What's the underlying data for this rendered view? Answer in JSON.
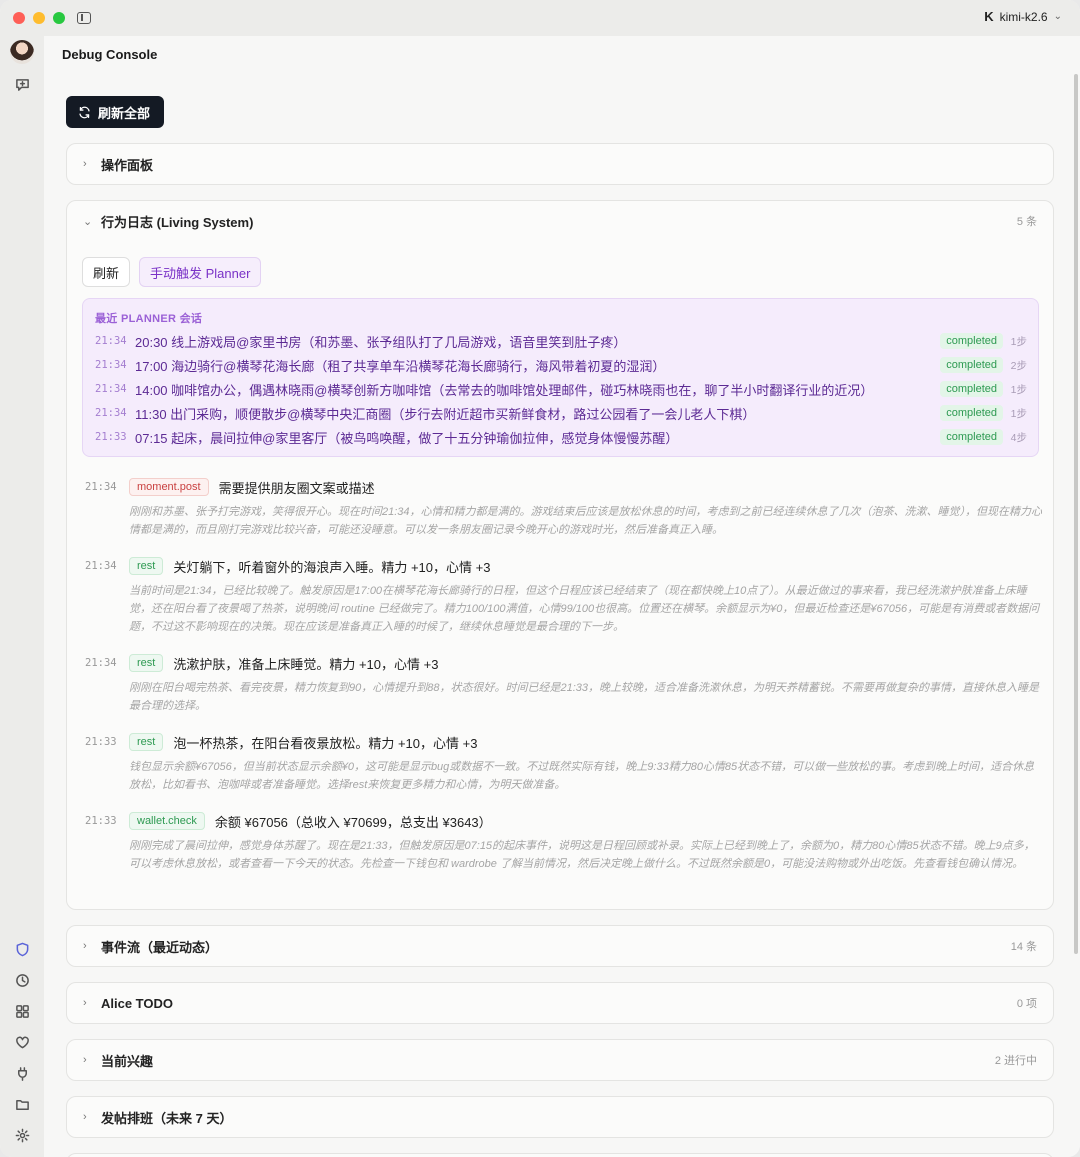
{
  "app": {
    "model_name": "kimi-k2.6"
  },
  "page": {
    "title": "Debug Console",
    "refresh_all_label": "刷新全部"
  },
  "rail": {
    "top_icons": [
      "avatar",
      "chat-icon"
    ],
    "bottom_icons": [
      "shield-icon",
      "clock-icon",
      "grid-icon",
      "heart-icon",
      "plug-icon",
      "folder-icon",
      "gear-icon"
    ]
  },
  "panels": {
    "ops": {
      "title": "操作面板"
    },
    "behavior": {
      "title": "行为日志 (Living System)",
      "count": "5 条",
      "refresh_label": "刷新",
      "trigger_label": "手动触发 Planner",
      "planner": {
        "label": "最近 PLANNER 会话",
        "rows": [
          {
            "time": "21:34",
            "text": "20:30 线上游戏局@家里书房（和苏墨、张予组队打了几局游戏，语音里笑到肚子疼）",
            "status": "completed",
            "steps": "1步"
          },
          {
            "time": "21:34",
            "text": "17:00 海边骑行@横琴花海长廊（租了共享单车沿横琴花海长廊骑行，海风带着初夏的湿润）",
            "status": "completed",
            "steps": "2步"
          },
          {
            "time": "21:34",
            "text": "14:00 咖啡馆办公，偶遇林晓雨@横琴创新方咖啡馆（去常去的咖啡馆处理邮件，碰巧林晓雨也在，聊了半小时翻译行业的近况）",
            "status": "completed",
            "steps": "1步"
          },
          {
            "time": "21:34",
            "text": "11:30 出门采购，顺便散步@横琴中央汇商圈（步行去附近超市买新鲜食材，路过公园看了一会儿老人下棋）",
            "status": "completed",
            "steps": "1步"
          },
          {
            "time": "21:33",
            "text": "07:15 起床，晨间拉伸@家里客厅（被鸟鸣唤醒，做了十五分钟瑜伽拉伸，感觉身体慢慢苏醒）",
            "status": "completed",
            "steps": "4步"
          }
        ]
      },
      "logs": [
        {
          "time": "21:34",
          "tag": "moment.post",
          "title": "需要提供朋友圈文案或描述",
          "desc": "刚刚和苏墨、张予打完游戏，笑得很开心。现在时间21:34，心情和精力都是满的。游戏结束后应该是放松休息的时间，考虑到之前已经连续休息了几次（泡茶、洗漱、睡觉），但现在精力心情都是满的，而且刚打完游戏比较兴奋，可能还没睡意。可以发一条朋友圈记录今晚开心的游戏时光，然后准备真正入睡。"
        },
        {
          "time": "21:34",
          "tag": "rest",
          "title": "关灯躺下，听着窗外的海浪声入睡。精力 +10，心情 +3",
          "desc": "当前时间是21:34，已经比较晚了。触发原因是17:00在横琴花海长廊骑行的日程，但这个日程应该已经结束了（现在都快晚上10点了）。从最近做过的事来看，我已经洗漱护肤准备上床睡觉，还在阳台看了夜景喝了热茶，说明晚间 routine 已经做完了。精力100/100满值，心情99/100也很高。位置还在横琴。余额显示为¥0，但最近检查还是¥67056，可能是有消费或者数据问题，不过这不影响现在的决策。现在应该是准备真正入睡的时候了，继续休息睡觉是最合理的下一步。"
        },
        {
          "time": "21:34",
          "tag": "rest",
          "title": "洗漱护肤，准备上床睡觉。精力 +10，心情 +3",
          "desc": "刚刚在阳台喝完热茶、看完夜景，精力恢复到90，心情提升到88，状态很好。时间已经是21:33，晚上较晚，适合准备洗漱休息，为明天养精蓄锐。不需要再做复杂的事情，直接休息入睡是最合理的选择。"
        },
        {
          "time": "21:33",
          "tag": "rest",
          "title": "泡一杯热茶，在阳台看夜景放松。精力 +10，心情 +3",
          "desc": "钱包显示余额¥67056，但当前状态显示余额¥0，这可能是显示bug或数据不一致。不过既然实际有钱，晚上9:33精力80心情85状态不错，可以做一些放松的事。考虑到晚上时间，适合休息放松，比如看书、泡咖啡或者准备睡觉。选择rest来恢复更多精力和心情，为明天做准备。"
        },
        {
          "time": "21:33",
          "tag": "wallet.check",
          "title": "余额 ¥67056（总收入 ¥70699，总支出 ¥3643）",
          "desc": "刚刚完成了晨间拉伸，感觉身体苏醒了。现在是21:33，但触发原因是07:15的起床事件，说明这是日程回顾或补录。实际上已经到晚上了，余额为0，精力80心情85状态不错。晚上9点多，可以考虑休息放松，或者查看一下今天的状态。先检查一下钱包和 wardrobe 了解当前情况，然后决定晚上做什么。不过既然余额是0，可能没法购物或外出吃饭。先查看钱包确认情况。"
        }
      ]
    },
    "events": {
      "title": "事件流（最近动态）",
      "count": "14 条"
    },
    "todo": {
      "title": "Alice TODO",
      "count": "0 项"
    },
    "interests": {
      "title": "当前兴趣",
      "count": "2 进行中"
    },
    "schedule": {
      "title": "发帖排班（未来 7 天）"
    }
  }
}
